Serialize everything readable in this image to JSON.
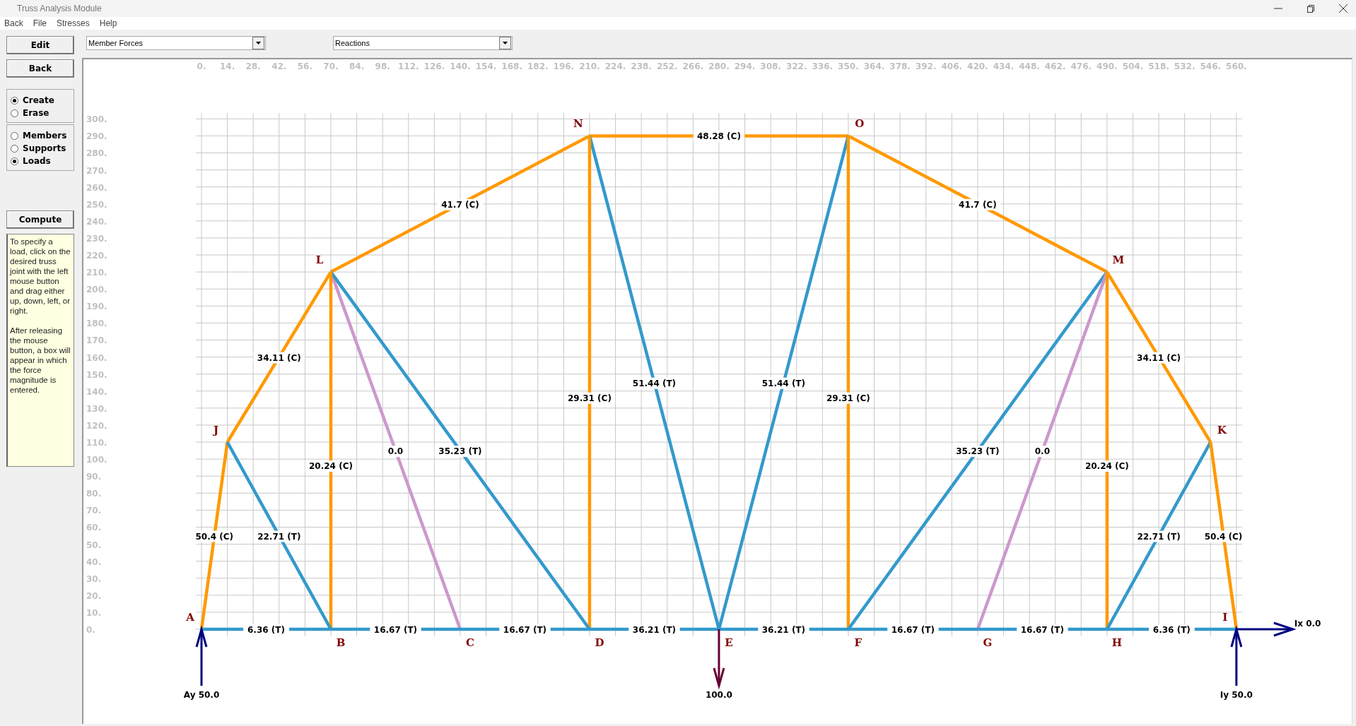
{
  "window": {
    "title": "Truss Analysis Module"
  },
  "menu": [
    "Back",
    "File",
    "Stresses",
    "Help"
  ],
  "buttons": {
    "edit": "Edit",
    "back": "Back",
    "compute": "Compute"
  },
  "mode_options": [
    {
      "label": "Create",
      "selected": true
    },
    {
      "label": "Erase",
      "selected": false
    }
  ],
  "element_options": [
    {
      "label": "Members",
      "selected": false
    },
    {
      "label": "Supports",
      "selected": false
    },
    {
      "label": "Loads",
      "selected": true
    }
  ],
  "help_text": [
    "To specify a load, click on the desired truss joint with the left mouse button and drag either up, down, left, or right.",
    "After releasing the mouse button, a box will appear in which the force magnitude is entered."
  ],
  "dropdowns": [
    {
      "value": "Member Forces"
    },
    {
      "value": "Reactions"
    }
  ],
  "x_ticks": [
    "0.",
    "14.",
    "28.",
    "42.",
    "56.",
    "70.",
    "84.",
    "98.",
    "112.",
    "126.",
    "140.",
    "154.",
    "168.",
    "182.",
    "196.",
    "210.",
    "224.",
    "238.",
    "252.",
    "266.",
    "280.",
    "294.",
    "308.",
    "322.",
    "336.",
    "350.",
    "364.",
    "378.",
    "392.",
    "406.",
    "420.",
    "434.",
    "448.",
    "462.",
    "476.",
    "490.",
    "504.",
    "518.",
    "532.",
    "546.",
    "560."
  ],
  "y_ticks": [
    "300.",
    "290.",
    "280.",
    "270.",
    "260.",
    "250.",
    "240.",
    "230.",
    "220.",
    "210.",
    "200.",
    "190.",
    "180.",
    "170.",
    "160.",
    "150.",
    "140.",
    "130.",
    "120.",
    "110.",
    "100.",
    "90.",
    "80.",
    "70.",
    "60.",
    "50.",
    "40.",
    "30.",
    "20.",
    "10.",
    "0."
  ],
  "nodes": [
    {
      "name": "N"
    },
    {
      "name": "O"
    },
    {
      "name": "L"
    },
    {
      "name": "M"
    },
    {
      "name": "J"
    },
    {
      "name": "K"
    },
    {
      "name": "A"
    },
    {
      "name": "I"
    },
    {
      "name": "B"
    },
    {
      "name": "C"
    },
    {
      "name": "D"
    },
    {
      "name": "E"
    },
    {
      "name": "F"
    },
    {
      "name": "G"
    },
    {
      "name": "H"
    }
  ],
  "members": [
    {
      "kind": "compression",
      "force": "48.28 (C)"
    },
    {
      "kind": "compression",
      "force": "41.7 (C)"
    },
    {
      "kind": "compression",
      "force": "41.7 (C)"
    },
    {
      "kind": "compression",
      "force": "34.11 (C)"
    },
    {
      "kind": "compression",
      "force": "34.11 (C)"
    },
    {
      "kind": "tension",
      "force": "51.44 (T)"
    },
    {
      "kind": "tension",
      "force": "51.44 (T)"
    },
    {
      "kind": "compression",
      "force": "29.31 (C)"
    },
    {
      "kind": "compression",
      "force": "29.31 (C)"
    },
    {
      "kind": "zero",
      "force": "0.0"
    },
    {
      "kind": "tension",
      "force": "35.23 (T)"
    },
    {
      "kind": "tension",
      "force": "35.23 (T)"
    },
    {
      "kind": "zero",
      "force": "0.0"
    },
    {
      "kind": "compression",
      "force": "20.24 (C)"
    },
    {
      "kind": "compression",
      "force": "20.24 (C)"
    },
    {
      "kind": "compression",
      "force": "50.4 (C)"
    },
    {
      "kind": "tension",
      "force": "22.71 (T)"
    },
    {
      "kind": "tension",
      "force": "22.71 (T)"
    },
    {
      "kind": "compression",
      "force": "50.4 (C)"
    },
    {
      "kind": "tension",
      "force": "6.36 (T)"
    },
    {
      "kind": "tension",
      "force": "16.67 (T)"
    },
    {
      "kind": "tension",
      "force": "16.67 (T)"
    },
    {
      "kind": "tension",
      "force": "36.21 (T)"
    },
    {
      "kind": "tension",
      "force": "36.21 (T)"
    },
    {
      "kind": "tension",
      "force": "16.67 (T)"
    },
    {
      "kind": "tension",
      "force": "16.67 (T)"
    },
    {
      "kind": "tension",
      "force": "6.36 (T)"
    }
  ],
  "forces": [
    {
      "kind": "reaction",
      "label": "Ix 0.0"
    },
    {
      "kind": "reaction",
      "label": "Ay 50.0"
    },
    {
      "kind": "load",
      "label": "100.0"
    },
    {
      "kind": "reaction",
      "label": "Iy 50.0"
    }
  ]
}
